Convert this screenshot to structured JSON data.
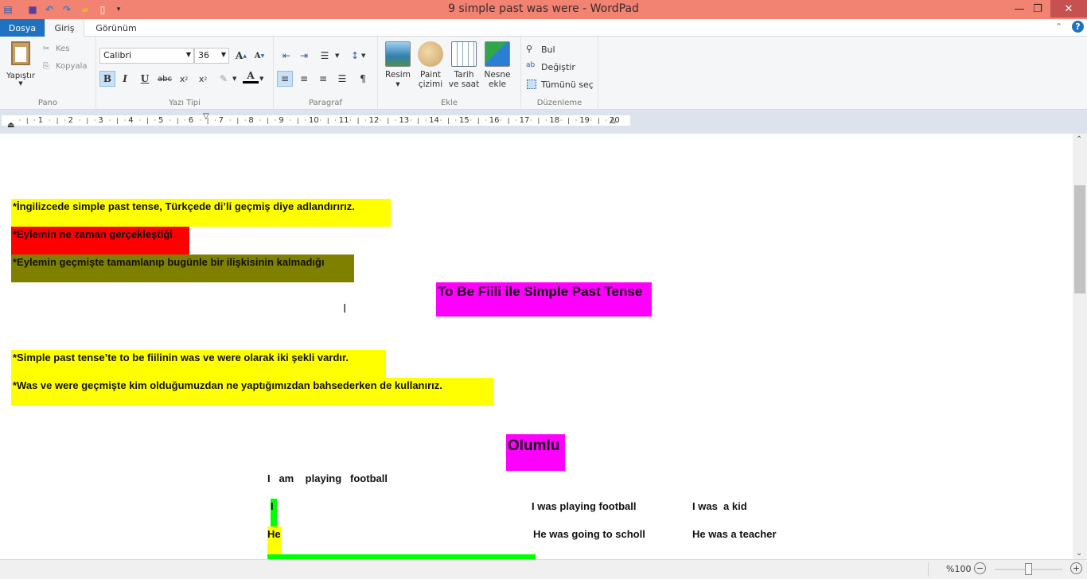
{
  "window": {
    "title": "9  simple past was were - WordPad",
    "titlebar_color": "#f28372"
  },
  "qat": {
    "icons": [
      "app-icon",
      "save-icon",
      "undo-icon",
      "redo-icon",
      "open-icon",
      "new-icon",
      "customize-icon"
    ]
  },
  "tabs": [
    {
      "label": "Dosya"
    },
    {
      "label": "Giriş"
    },
    {
      "label": "Görünüm"
    }
  ],
  "ribbon": {
    "pano": {
      "label": "Pano",
      "paste": "Yapıştır",
      "cut": "Kes",
      "copy": "Kopyala"
    },
    "font": {
      "label": "Yazı Tipi",
      "family": "Calibri",
      "size": "36"
    },
    "paragraph": {
      "label": "Paragraf"
    },
    "insert": {
      "label": "Ekle",
      "picture": "Resim",
      "paint_line1": "Paint",
      "paint_line2": "çizimi",
      "date_line1": "Tarih",
      "date_line2": "ve saat",
      "object_line1": "Nesne",
      "object_line2": "ekle"
    },
    "editing": {
      "label": "Düzenleme",
      "find": "Bul",
      "replace": "Değiştir",
      "select_all": "Tümünü seç"
    }
  },
  "ruler": {
    "ticks": [
      "1",
      "2",
      "3",
      "4",
      "5",
      "6",
      "7",
      "8",
      "9",
      "10",
      "11",
      "12",
      "13",
      "14",
      "15",
      "16",
      "17",
      "18",
      "19",
      "20"
    ]
  },
  "document": {
    "lines": [
      {
        "text": "*İngilizcede simple past  tense, Türkçede di’li geçmiş  diye adlandırırız.",
        "highlight": "#ffff00"
      },
      {
        "text": "*Eylemin ne zaman gerçekleştiği",
        "highlight": "#ff0000"
      },
      {
        "text": "*Eylemin geçmişte tamamlanıp bugünle bir ilişkisinin kalmadığı",
        "highlight": "#808000"
      },
      {
        "text": "To Be Fiili ile Simple Past Tense",
        "highlight": "#ff00ff"
      },
      {
        "text": "*Simple past tense’te to be fiilinin was ve were olarak iki şekli vardır.",
        "highlight": "#ffff00"
      },
      {
        "text": "*Was ve were  geçmişte kim olduğumuzdan ne yaptığımızdan bahsederken  de kullanırız.",
        "highlight": "#ffff00"
      },
      {
        "text": "Olumlu",
        "highlight": "#ff00ff"
      },
      {
        "text": "I   am    playing   football",
        "highlight": ""
      },
      {
        "text": "I",
        "highlight": "#00ff00"
      },
      {
        "text": "I was playing football",
        "highlight": ""
      },
      {
        "text": "I was  a kid",
        "highlight": ""
      },
      {
        "text": "He",
        "highlight": "#ffff00"
      },
      {
        "text": "He was going to scholl",
        "highlight": ""
      },
      {
        "text": "He was a teacher",
        "highlight": ""
      }
    ]
  },
  "status": {
    "zoom": "%100"
  }
}
